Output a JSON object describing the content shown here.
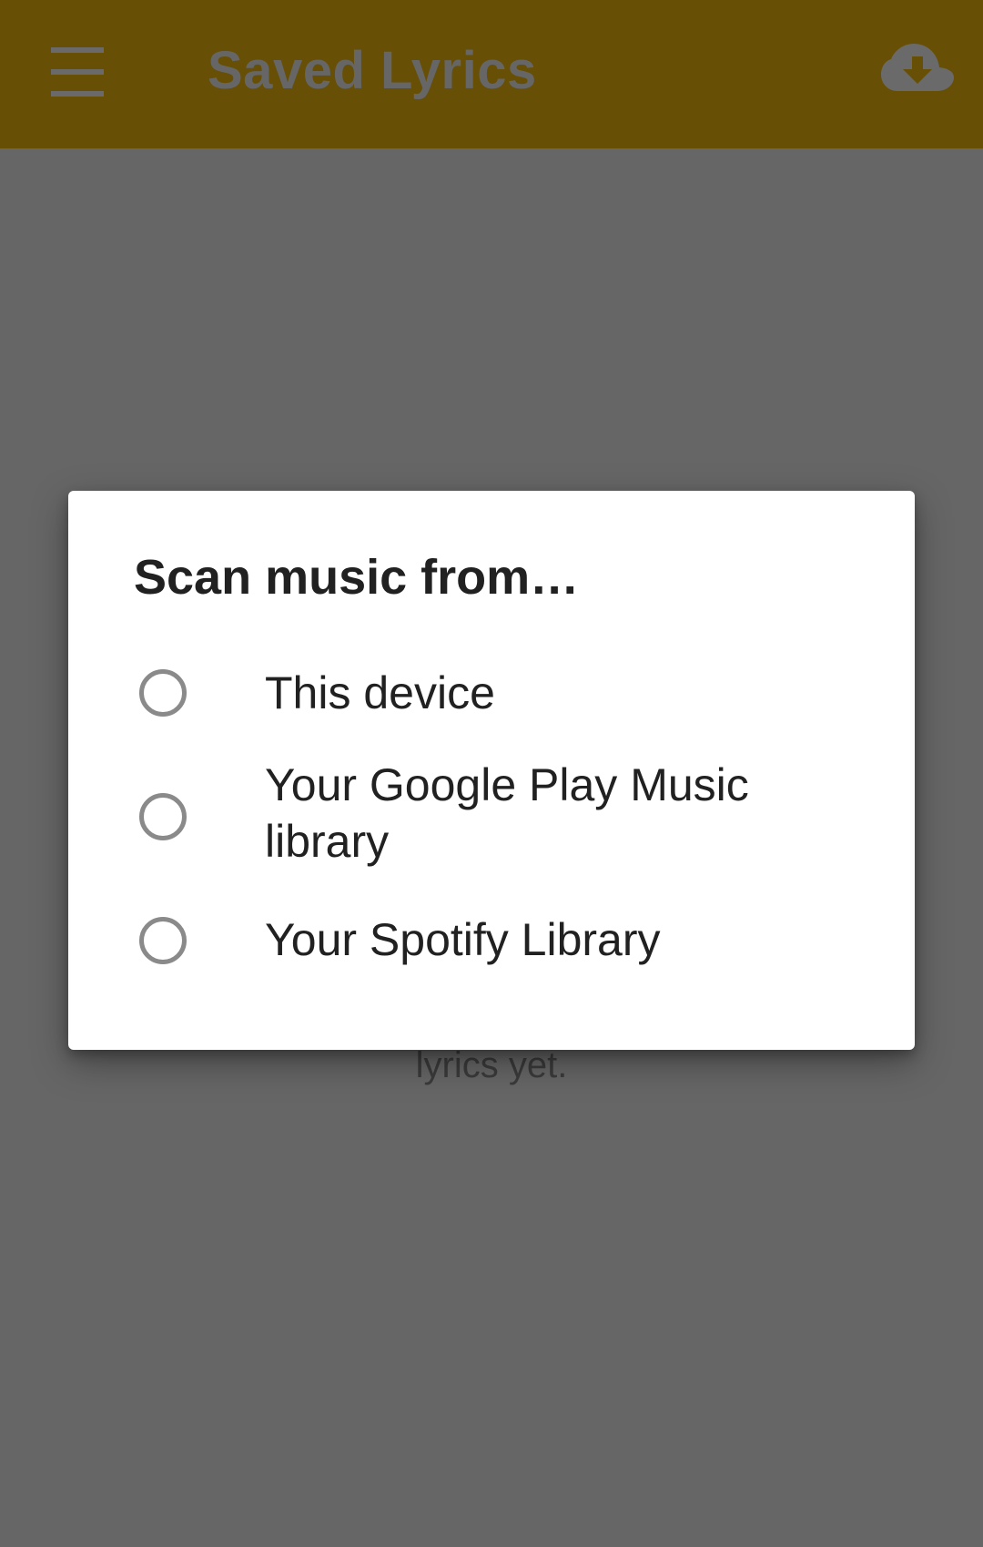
{
  "toolbar": {
    "title": "Saved Lyrics",
    "menu_icon": "menu-icon",
    "action_icon": "cloud-download-icon",
    "color": "#674f05"
  },
  "content": {
    "empty_text": "lyrics yet."
  },
  "dialog": {
    "title": "Scan music from…",
    "options": [
      {
        "label": "This device",
        "selected": false
      },
      {
        "label": "Your Google Play Music library",
        "selected": false
      },
      {
        "label": "Your Spotify Library",
        "selected": false
      }
    ]
  }
}
